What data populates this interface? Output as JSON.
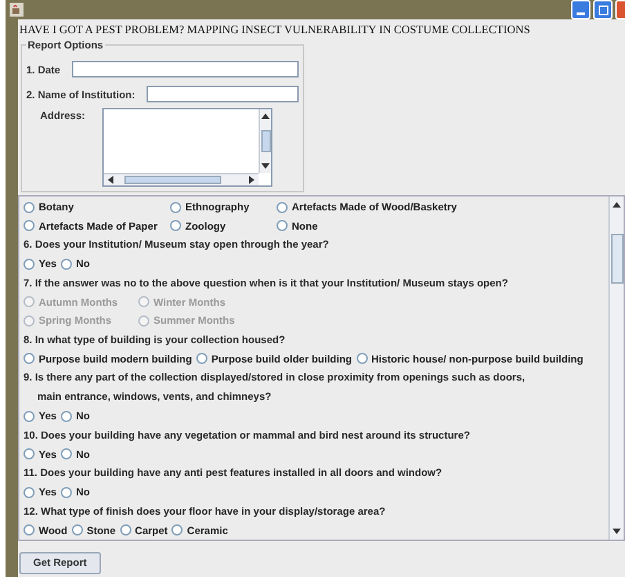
{
  "heading": "HAVE I GOT A PEST PROBLEM? MAPPING INSECT VULNERABILITY IN COSTUME COLLECTIONS",
  "report_options": {
    "title": "Report Options",
    "date_label": "1. Date",
    "institution_label": "2. Name of Institution:",
    "address_label": "Address:"
  },
  "form_rows": [
    {
      "kind": "three-column",
      "options": [
        {
          "label": "Botany",
          "selected": false,
          "disabled": false
        },
        {
          "label": "Ethnography",
          "selected": false,
          "disabled": false
        },
        {
          "label": "Artefacts Made of Wood/Basketry",
          "selected": false,
          "disabled": false
        }
      ]
    },
    {
      "kind": "three-column",
      "options": [
        {
          "label": "Artefacts Made of Paper",
          "selected": false,
          "disabled": false
        },
        {
          "label": "Zoology",
          "selected": false,
          "disabled": false
        },
        {
          "label": "None",
          "selected": false,
          "disabled": false
        }
      ]
    },
    {
      "kind": "question",
      "text": "6. Does your Institution/ Museum stay open through the year?"
    },
    {
      "kind": "inline",
      "options": [
        {
          "label": "Yes",
          "selected": false,
          "disabled": false
        },
        {
          "label": "No",
          "selected": false,
          "disabled": false
        }
      ]
    },
    {
      "kind": "question",
      "text": "7. If the answer was no to the above question when is it that your Institution/ Museum stays open?"
    },
    {
      "kind": "two-column",
      "options": [
        {
          "label": "Autumn Months",
          "selected": false,
          "disabled": true
        },
        {
          "label": "Winter Months",
          "selected": false,
          "disabled": true
        }
      ]
    },
    {
      "kind": "two-column",
      "options": [
        {
          "label": "Spring Months",
          "selected": false,
          "disabled": true
        },
        {
          "label": "Summer Months",
          "selected": false,
          "disabled": true
        }
      ]
    },
    {
      "kind": "question",
      "text": "8.  In what type of building is your collection housed?"
    },
    {
      "kind": "inline",
      "options": [
        {
          "label": "Purpose build modern building",
          "selected": false,
          "disabled": false
        },
        {
          "label": "Purpose build older building",
          "selected": false,
          "disabled": false
        },
        {
          "label": "Historic house/ non-purpose build building",
          "selected": false,
          "disabled": false
        }
      ]
    },
    {
      "kind": "question",
      "text": "9. Is there any part of the collection displayed/stored in close proximity from openings such as doors, main entrance, windows, vents, and chimneys?"
    },
    {
      "kind": "inline",
      "options": [
        {
          "label": "Yes",
          "selected": false,
          "disabled": false
        },
        {
          "label": "No",
          "selected": false,
          "disabled": false
        }
      ]
    },
    {
      "kind": "question",
      "text": "10. Does your building have any vegetation or mammal and bird nest around its structure?"
    },
    {
      "kind": "inline",
      "options": [
        {
          "label": "Yes",
          "selected": false,
          "disabled": false
        },
        {
          "label": "No",
          "selected": false,
          "disabled": false
        }
      ]
    },
    {
      "kind": "question",
      "text": "11. Does your building have any anti pest features installed in all doors and window?"
    },
    {
      "kind": "inline",
      "options": [
        {
          "label": "Yes",
          "selected": false,
          "disabled": false
        },
        {
          "label": "No",
          "selected": false,
          "disabled": false
        }
      ]
    },
    {
      "kind": "question",
      "text": "12. What type of finish does your floor have in your display/storage area?"
    },
    {
      "kind": "inline",
      "options": [
        {
          "label": "Wood",
          "selected": false,
          "disabled": false
        },
        {
          "label": "Stone",
          "selected": false,
          "disabled": false
        },
        {
          "label": "Carpet",
          "selected": false,
          "disabled": false
        },
        {
          "label": "Ceramic",
          "selected": false,
          "disabled": false
        }
      ]
    }
  ],
  "get_report_button": "Get Report"
}
